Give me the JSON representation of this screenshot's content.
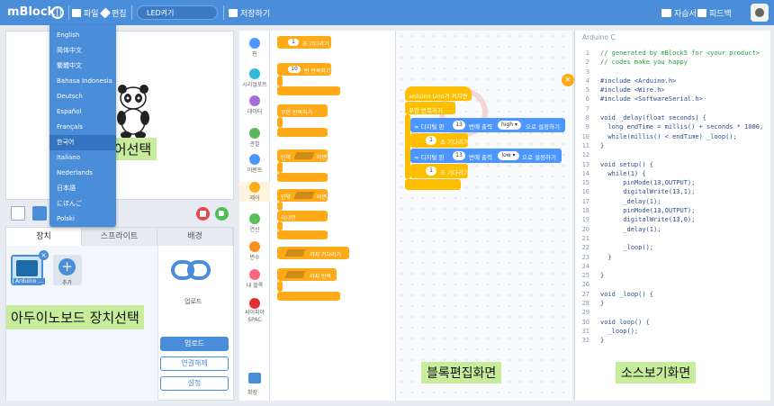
{
  "topbar": {
    "brand": "mBlock",
    "file": "파일",
    "edit": "편집",
    "project_name": "LED켜기",
    "save": "저장하기",
    "tutorial": "자습서",
    "feedback": "피드백"
  },
  "language_menu": [
    "English",
    "简体中文",
    "繁體中文",
    "Bahasa Indonesia",
    "Deutsch",
    "Español",
    "Français",
    "한국어",
    "Italiano",
    "Nederlands",
    "日本語",
    "にほんご",
    "Polski"
  ],
  "language_selected": "한국어",
  "annotations": {
    "language": "언어선택",
    "device": "아두이노보드 장치선택",
    "block_editor": "블록편집화면",
    "source_view": "소스보기화면"
  },
  "device_tabs": [
    "장치",
    "스프라이트",
    "배경"
  ],
  "devices": {
    "arduino_label": "Arduino ...",
    "add_label": "추가"
  },
  "device_actions": {
    "upload_small": "업로드",
    "upload": "업로드",
    "disconnect": "연결해제",
    "settings": "설정"
  },
  "categories": [
    {
      "label": "핀",
      "color": "#4c97ff"
    },
    {
      "label": "시리얼포트",
      "color": "#2fb8d8"
    },
    {
      "label": "데이터",
      "color": "#a66be0"
    },
    {
      "label": "관찰",
      "color": "#5cb85c"
    },
    {
      "label": "이벤트",
      "color": "#4c97ff"
    },
    {
      "label": "제어",
      "color": "#ffab19"
    },
    {
      "label": "연산",
      "color": "#59c059"
    },
    {
      "label": "변수",
      "color": "#ff8c1a"
    },
    {
      "label": "내 블록",
      "color": "#ff6680"
    },
    {
      "label": "싸이피아 SPAC",
      "color": "#e03131"
    }
  ],
  "extension_label": "확장",
  "palette": {
    "wait_num": "1",
    "wait": "초 기다리기",
    "repeat_num": "10",
    "repeat": "번 반복하기",
    "forever": "무한 반복하기",
    "if_label": "만약",
    "then": "이면",
    "else": "아니면",
    "wait_until": "까지 기다리기",
    "repeat_until": "까지 반복"
  },
  "script": {
    "hat": "arduino Uno가 켜지면",
    "forever": "무한 반복하기",
    "digital_pin": "디지털 핀",
    "pin_num": "13",
    "output_to": "번에 출력",
    "high": "high ▾",
    "low": "low ▾",
    "set": "으로 설정하기",
    "wait_num": "1",
    "wait": "초 기다리기"
  },
  "code": {
    "header": "Arduino C",
    "lines": [
      {
        "n": "1",
        "t": "// generated by mBlock5 for <your product>",
        "c": "cm"
      },
      {
        "n": "2",
        "t": "// codes make you happy",
        "c": "cm"
      },
      {
        "n": "3",
        "t": "",
        "c": "kw"
      },
      {
        "n": "4",
        "t": "#include <Arduino.h>",
        "c": "kw"
      },
      {
        "n": "5",
        "t": "#include <Wire.h>",
        "c": "kw"
      },
      {
        "n": "6",
        "t": "#include <SoftwareSerial.h>",
        "c": "kw"
      },
      {
        "n": "7",
        "t": "",
        "c": "kw"
      },
      {
        "n": "8",
        "t": "void _delay(float seconds) {",
        "c": "kw"
      },
      {
        "n": "9",
        "t": "  long endTime = millis() + seconds * 1000;",
        "c": "kw"
      },
      {
        "n": "10",
        "t": "  while(millis() < endTime) _loop();",
        "c": "kw"
      },
      {
        "n": "11",
        "t": "}",
        "c": "kw"
      },
      {
        "n": "12",
        "t": "",
        "c": "kw"
      },
      {
        "n": "13",
        "t": "void setup() {",
        "c": "kw"
      },
      {
        "n": "14",
        "t": "  while(1) {",
        "c": "kw"
      },
      {
        "n": "15",
        "t": "      pinMode(13,OUTPUT);",
        "c": "kw"
      },
      {
        "n": "16",
        "t": "      digitalWrite(13,1);",
        "c": "kw"
      },
      {
        "n": "17",
        "t": "      _delay(1);",
        "c": "kw"
      },
      {
        "n": "18",
        "t": "      pinMode(13,OUTPUT);",
        "c": "kw"
      },
      {
        "n": "19",
        "t": "      digitalWrite(13,0);",
        "c": "kw"
      },
      {
        "n": "20",
        "t": "      _delay(1);",
        "c": "kw"
      },
      {
        "n": "21",
        "t": "",
        "c": "kw"
      },
      {
        "n": "22",
        "t": "      _loop();",
        "c": "kw"
      },
      {
        "n": "23",
        "t": "  }",
        "c": "kw"
      },
      {
        "n": "24",
        "t": "",
        "c": "kw"
      },
      {
        "n": "25",
        "t": "}",
        "c": "kw"
      },
      {
        "n": "26",
        "t": "",
        "c": "kw"
      },
      {
        "n": "27",
        "t": "void _loop() {",
        "c": "kw"
      },
      {
        "n": "28",
        "t": "}",
        "c": "kw"
      },
      {
        "n": "29",
        "t": "",
        "c": "kw"
      },
      {
        "n": "30",
        "t": "void loop() {",
        "c": "kw"
      },
      {
        "n": "31",
        "t": "  _loop();",
        "c": "kw"
      },
      {
        "n": "32",
        "t": "}",
        "c": "kw"
      }
    ]
  }
}
